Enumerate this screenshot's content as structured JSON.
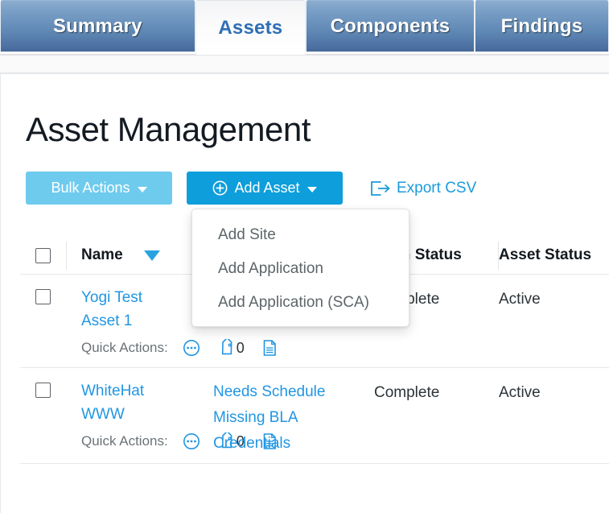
{
  "tabs": [
    {
      "label": "Summary",
      "active": false
    },
    {
      "label": "Assets",
      "active": true
    },
    {
      "label": "Components",
      "active": false
    },
    {
      "label": "Findings",
      "active": false
    }
  ],
  "page": {
    "title": "Asset Management"
  },
  "toolbar": {
    "bulk_actions_label": "Bulk Actions",
    "add_asset_label": "Add Asset",
    "export_csv_label": "Export CSV",
    "add_asset_icon": "plus-circle-icon",
    "export_icon": "export-arrow-icon"
  },
  "add_asset_menu": {
    "open": true,
    "items": [
      {
        "label": "Add Site"
      },
      {
        "label": "Add Application"
      },
      {
        "label": "Add Application (SCA)"
      }
    ]
  },
  "table": {
    "headers": {
      "select_all": "",
      "name": "Name",
      "alerts": "",
      "scan_status": "Scan Status",
      "asset_status": "Asset Status"
    },
    "sort": {
      "column": "Name",
      "direction": "desc",
      "icon": "sort-descending-triangle-icon"
    },
    "quick_actions_label": "Quick Actions:",
    "quick_action_icons": [
      "ellipsis-circle-icon",
      "tag-icon",
      "document-icon"
    ],
    "rows": [
      {
        "selected": false,
        "name_line1": "Yogi Test",
        "name_line2": "Asset 1",
        "alerts": [],
        "scan_status": "Complete",
        "asset_status": "Active",
        "tag_count": "0"
      },
      {
        "selected": false,
        "name_line1": "WhiteHat",
        "name_line2": "WWW",
        "alerts": [
          "Needs Schedule",
          "Missing BLA",
          "Credentials"
        ],
        "scan_status": "Complete",
        "asset_status": "Active",
        "tag_count": "0"
      }
    ]
  },
  "colors": {
    "tab_blue_top": "#8badcf",
    "tab_blue_bottom": "#47699b",
    "active_tab_text": "#2f6fb5",
    "bulk_actions_bg": "#6ecbee",
    "add_asset_bg": "#0d9edb",
    "link_blue": "#2196e3",
    "sort_triangle": "#29a3e0"
  }
}
